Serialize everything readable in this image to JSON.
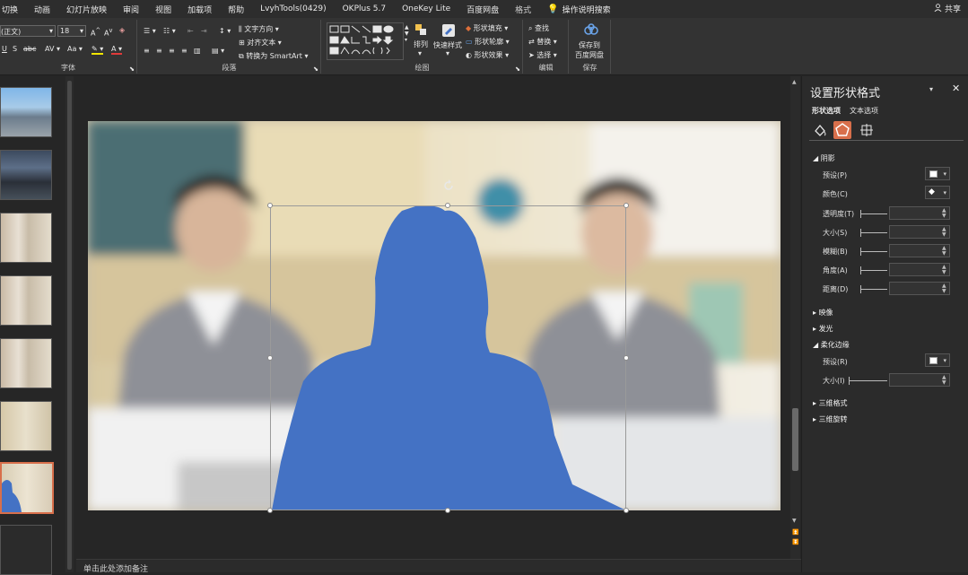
{
  "menubar": {
    "items": [
      "切换",
      "动画",
      "幻灯片放映",
      "审阅",
      "视图",
      "加载项",
      "帮助",
      "LvyhTools(0429)",
      "OKPlus 5.7",
      "OneKey Lite",
      "百度网盘",
      "格式"
    ],
    "search": "操作说明搜索",
    "share": "共享"
  },
  "ribbon": {
    "font": {
      "font_name": "(正文)",
      "font_size": "18",
      "label": "字体"
    },
    "paragraph": {
      "text_direction": "文字方向",
      "align_text": "对齐文本",
      "smartart": "转换为 SmartArt",
      "label": "段落"
    },
    "drawing": {
      "arrange": "排列",
      "quick_styles": "快速样式",
      "shape_fill": "形状填充",
      "shape_outline": "形状轮廓",
      "shape_effects": "形状效果",
      "label": "绘图"
    },
    "editing": {
      "find": "查找",
      "replace": "替换",
      "select": "选择",
      "label": "编辑"
    },
    "save": {
      "button": "保存到",
      "button2": "百度网盘",
      "label": "保存"
    }
  },
  "notes": {
    "placeholder": "单击此处添加备注"
  },
  "pane": {
    "title": "设置形状格式",
    "tabs": [
      "形状选项",
      "文本选项"
    ],
    "shadow": {
      "header": "阴影",
      "preset": "预设(P)",
      "color": "颜色(C)",
      "transparency": "透明度(T)",
      "size": "大小(S)",
      "blur": "模糊(B)",
      "angle": "角度(A)",
      "distance": "距离(D)"
    },
    "reflection": "映像",
    "glow": "发光",
    "soft_edges": {
      "header": "柔化边缘",
      "preset": "预设(R)",
      "size": "大小(I)"
    },
    "format_3d": "三维格式",
    "rotation_3d": "三维旋转"
  },
  "colors": {
    "silhouette": "#4472c4",
    "selected_thumb": "#d86f4b"
  }
}
